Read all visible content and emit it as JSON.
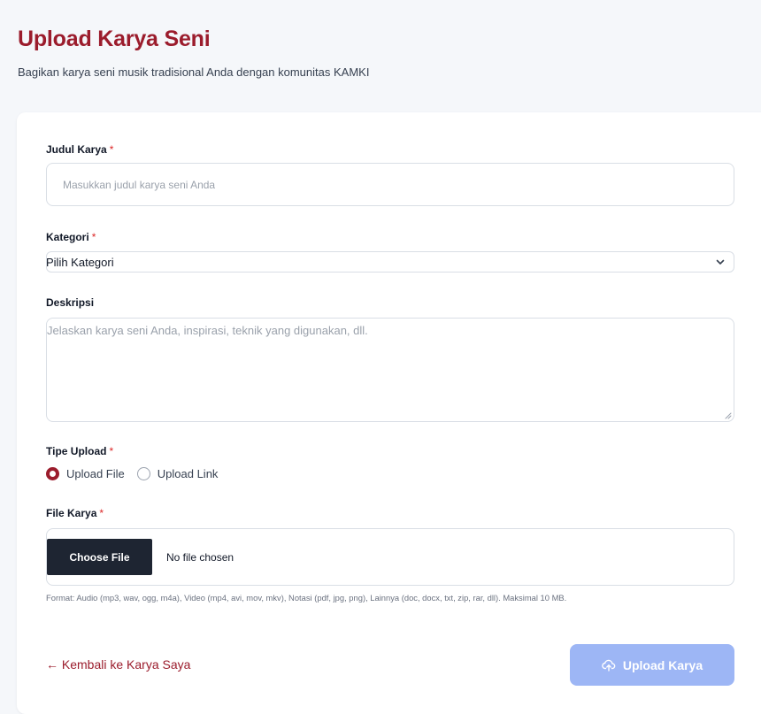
{
  "header": {
    "title": "Upload Karya Seni",
    "subtitle": "Bagikan karya seni musik tradisional Anda dengan komunitas KAMKI"
  },
  "form": {
    "title_field": {
      "label": "Judul Karya",
      "required_mark": "*",
      "value": "",
      "placeholder": "Masukkan judul karya seni Anda"
    },
    "category_field": {
      "label": "Kategori",
      "required_mark": "*",
      "selected": "Pilih Kategori",
      "icon": "chevron-down-icon"
    },
    "description_field": {
      "label": "Deskripsi",
      "value": "",
      "placeholder": "Jelaskan karya seni Anda, inspirasi, teknik yang digunakan, dll."
    },
    "upload_type": {
      "label": "Tipe Upload",
      "required_mark": "*",
      "options": [
        {
          "label": "Upload File",
          "checked": true
        },
        {
          "label": "Upload Link",
          "checked": false
        }
      ]
    },
    "file_field": {
      "label": "File Karya",
      "required_mark": "*",
      "button_label": "Choose File",
      "status": "No file chosen",
      "help": "Format: Audio (mp3, wav, ogg, m4a), Video (mp4, avi, mov, mkv), Notasi (pdf, jpg, png), Lainnya (doc, docx, txt, zip, rar, dll). Maksimal 10 MB."
    }
  },
  "actions": {
    "back_label": "← Kembali ke Karya Saya",
    "submit_label": "Upload Karya",
    "submit_icon": "cloud-upload-icon"
  },
  "colors": {
    "accent": "#9b1c2c",
    "required": "#dc2626",
    "submit_disabled": "#9db6f5",
    "choose_file_bg": "#1e2532",
    "page_bg": "#f5f7fa"
  }
}
